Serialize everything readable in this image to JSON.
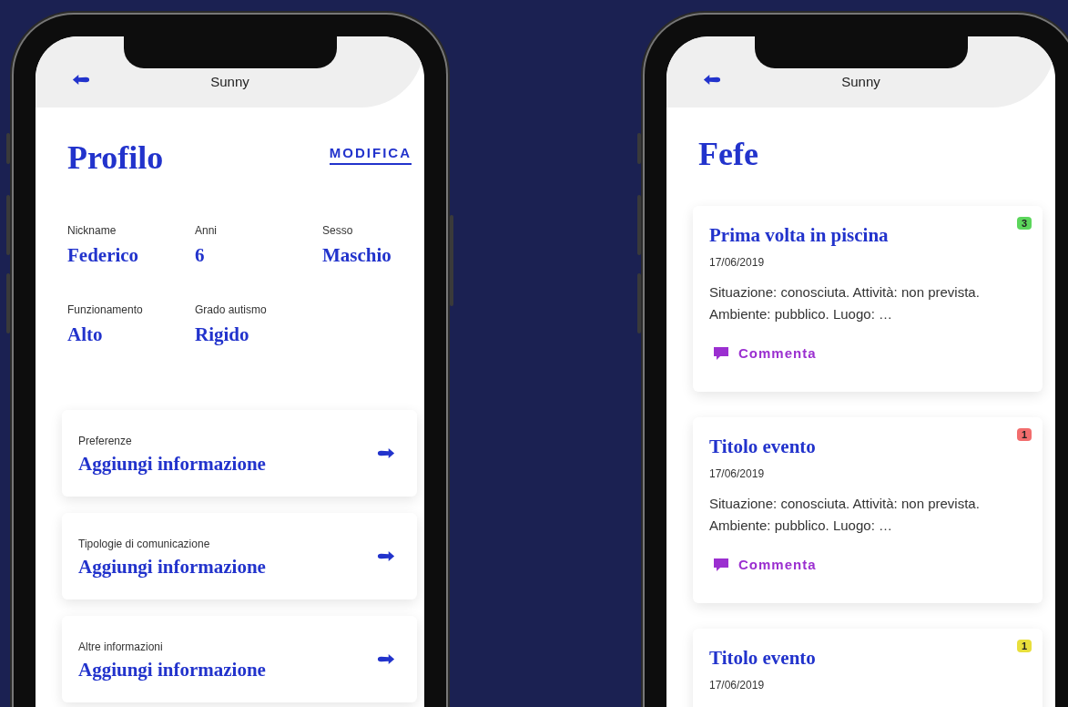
{
  "profile_screen": {
    "header_title": "Sunny",
    "title": "Profilo",
    "edit_link": "MODIFICA",
    "fields": [
      {
        "label": "Nickname",
        "value": "Federico"
      },
      {
        "label": "Anni",
        "value": "6"
      },
      {
        "label": "Sesso",
        "value": "Maschio"
      },
      {
        "label": "Funzionamento",
        "value": "Alto"
      },
      {
        "label": "Grado autismo",
        "value": "Rigido"
      }
    ],
    "info_cards": [
      {
        "label": "Preferenze",
        "action": "Aggiungi informazione"
      },
      {
        "label": "Tipologie di comunicazione",
        "action": "Aggiungi informazione"
      },
      {
        "label": "Altre informazioni",
        "action": "Aggiungi informazione"
      }
    ]
  },
  "events_screen": {
    "header_title": "Sunny",
    "title": "Fefe",
    "events": [
      {
        "title": "Prima volta in piscina",
        "date": "17/06/2019",
        "description": "Situazione: conosciuta. Attività: non prevista. Ambiente: pubblico. Luogo: …",
        "comment_action": "Commenta",
        "badge": "3",
        "color": "#5cd65c"
      },
      {
        "title": "Titolo evento",
        "date": "17/06/2019",
        "description": "Situazione: conosciuta. Attività: non prevista. Ambiente: pubblico. Luogo: …",
        "comment_action": "Commenta",
        "badge": "1",
        "color": "#f26d6d"
      },
      {
        "title": "Titolo evento",
        "date": "17/06/2019",
        "badge": "1",
        "color": "#e8df3c"
      }
    ]
  }
}
